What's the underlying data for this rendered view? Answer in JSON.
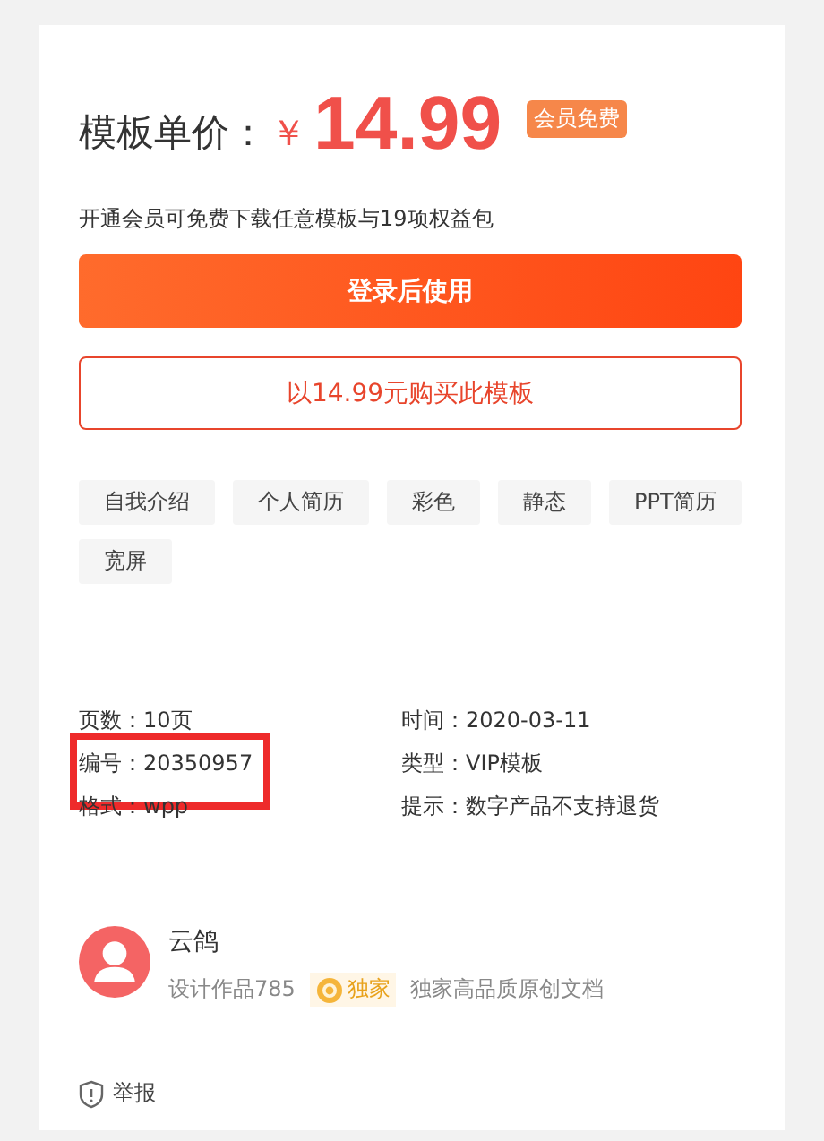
{
  "price": {
    "label": "模板单价：",
    "currency": "￥",
    "amount": "14.99",
    "badge": "会员免费"
  },
  "vip_note": "开通会员可免费下载任意模板与19项权益包",
  "buttons": [
    {
      "label": "登录后使用",
      "kind": "primary"
    },
    {
      "label": "以14.99元购买此模板",
      "kind": "outline"
    }
  ],
  "tags": [
    "自我介绍",
    "个人简历",
    "彩色",
    "静态",
    "PPT简历",
    "宽屏"
  ],
  "info": [
    {
      "text": "页数：10页"
    },
    {
      "text": "时间：2020-03-11"
    },
    {
      "text": "编号：20350957",
      "highlighted": true
    },
    {
      "text": "类型：VIP模板"
    },
    {
      "text": "格式：wpp"
    },
    {
      "text": "提示：数字产品不支持退货"
    }
  ],
  "author": {
    "name": "云鸽",
    "works": "设计作品785",
    "badge": "独家",
    "note": "独家高品质原创文档"
  },
  "report": "举报"
}
